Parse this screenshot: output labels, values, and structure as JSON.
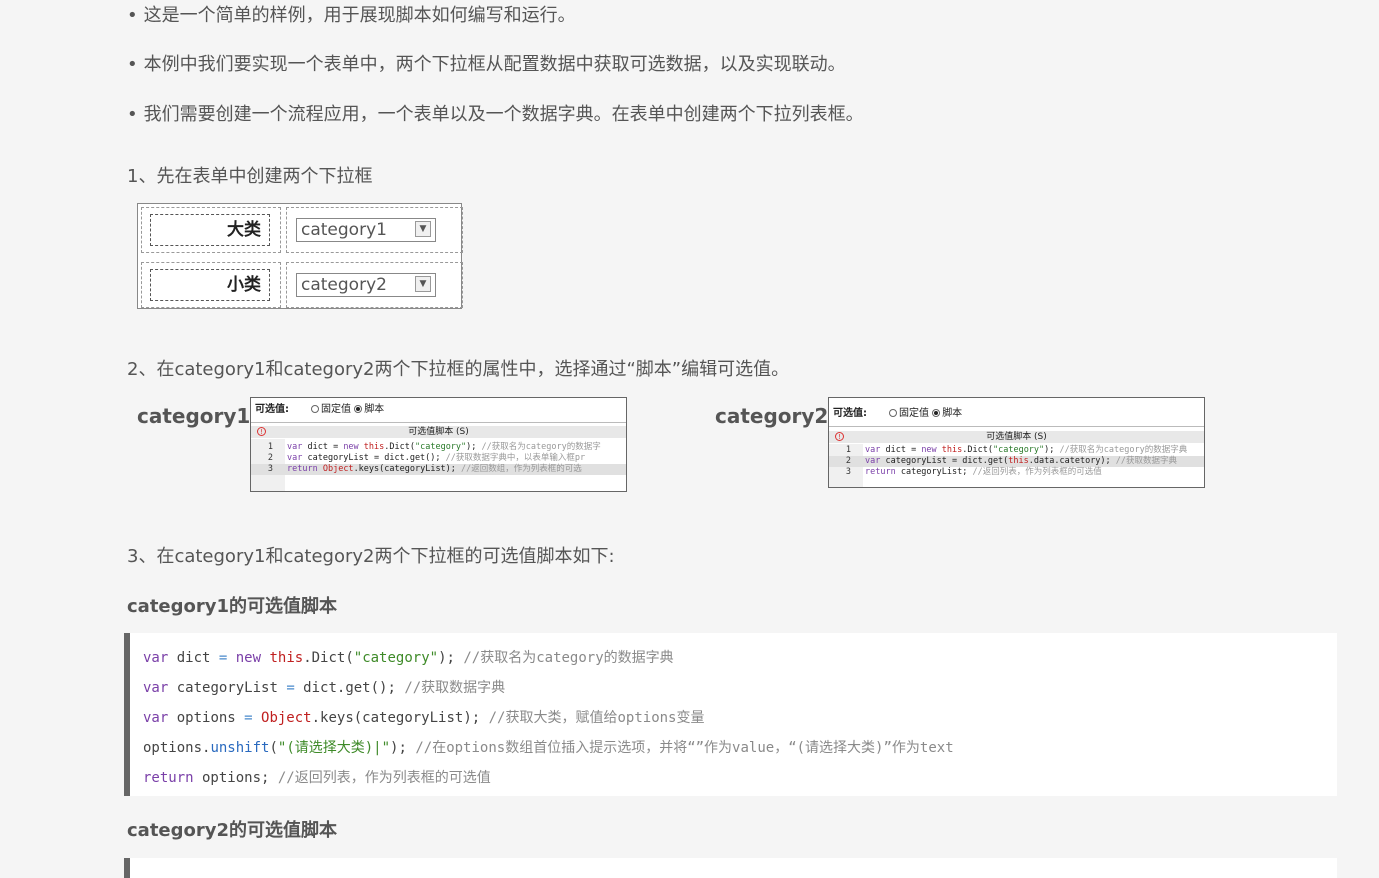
{
  "bullets": [
    "这是一个简单的样例，用于展现脚本如何编写和运行。",
    "本例中我们要实现一个表单中，两个下拉框从配置数据中获取可选数据，以及实现联动。",
    "我们需要创建一个流程应用，一个表单以及一个数据字典。在表单中创建两个下拉列表框。"
  ],
  "bullet_marker": "•",
  "step1": "1、先在表单中创建两个下拉框",
  "form": {
    "rows": [
      {
        "label": "大类",
        "value": "category1"
      },
      {
        "label": "小类",
        "value": "category2"
      }
    ],
    "arrow_icon": "dropdown-arrow-icon"
  },
  "step2": "2、在category1和category2两个下拉框的属性中，选择通过“脚本”编辑可选值。",
  "shots": [
    {
      "label": "category1",
      "field_label": "可选值:",
      "opt_fixed": "固定值",
      "opt_script": "脚本",
      "header": "可选值脚本 (S)",
      "lines": [
        {
          "n": "1",
          "kw": "var",
          "code": " dict = ",
          "kw2": "new",
          "red": " this",
          "code2": ".Dict(",
          "str": "\"category\"",
          "code3": "); ",
          "cm": "//获取名为category的数据字"
        },
        {
          "n": "2",
          "kw": "var",
          "code": " categoryList = dict.get(); ",
          "kw2": "",
          "red": "",
          "code2": "",
          "str": "",
          "code3": "",
          "cm": "//获取数据字典中，以表单输入框pr"
        },
        {
          "n": "3",
          "kw": "return",
          "code": " ",
          "kw2": "",
          "red": "Object",
          "code2": ".keys(categoryList); ",
          "str": "",
          "code3": "",
          "cm": "//返回数组，作为列表框的可选"
        }
      ]
    },
    {
      "label": "category2",
      "field_label": "可选值:",
      "opt_fixed": "固定值",
      "opt_script": "脚本",
      "header": "可选值脚本 (S)",
      "lines": [
        {
          "n": "1",
          "kw": "var",
          "code": " dict = ",
          "kw2": "new",
          "red": " this",
          "code2": ".Dict(",
          "str": "\"category\"",
          "code3": "); ",
          "cm": "//获取名为category的数据字典"
        },
        {
          "n": "2",
          "kw": "var",
          "code": " categoryList = dict.get(",
          "kw2": "",
          "red": "this",
          "code2": ".data.catetory); ",
          "str": "",
          "code3": "",
          "cm": "//获取数据字典"
        },
        {
          "n": "3",
          "kw": "return",
          "code": " categoryList; ",
          "kw2": "",
          "red": "",
          "code2": "",
          "str": "",
          "code3": "",
          "cm": "//返回列表，作为列表框的可选值"
        }
      ]
    }
  ],
  "step3": "3、在category1和category2两个下拉框的可选值脚本如下:",
  "h_cat1": "category1的可选值脚本",
  "code1": {
    "l1": {
      "kw": "var",
      "a": " dict ",
      "op": "=",
      "kw2": " new",
      "red": " this",
      "b": ".Dict(",
      "str": "\"category\"",
      "c": ");   ",
      "cm": "//获取名为category的数据字典"
    },
    "l2": {
      "kw": "var",
      "a": " categoryList ",
      "op": "=",
      "b": " dict.get();  ",
      "cm": "//获取数据字典"
    },
    "l3": {
      "kw": "var",
      "a": " options ",
      "op": "=",
      "red": " Object",
      "b": ".keys(categoryList);    ",
      "cm": "//获取大类，赋值给options变量"
    },
    "l4": {
      "a": "options.",
      "fn": "unshift",
      "b": "(",
      "str": "\"(请选择大类)|\"",
      "c": ");   ",
      "cm": "//在options数组首位插入提示选项，并将“”作为value，“(请选择大类)”作为text"
    },
    "l5": {
      "kw": "return",
      "a": " options; ",
      "cm": "//返回列表，作为列表框的可选值"
    }
  },
  "h_cat2": "category2的可选值脚本"
}
